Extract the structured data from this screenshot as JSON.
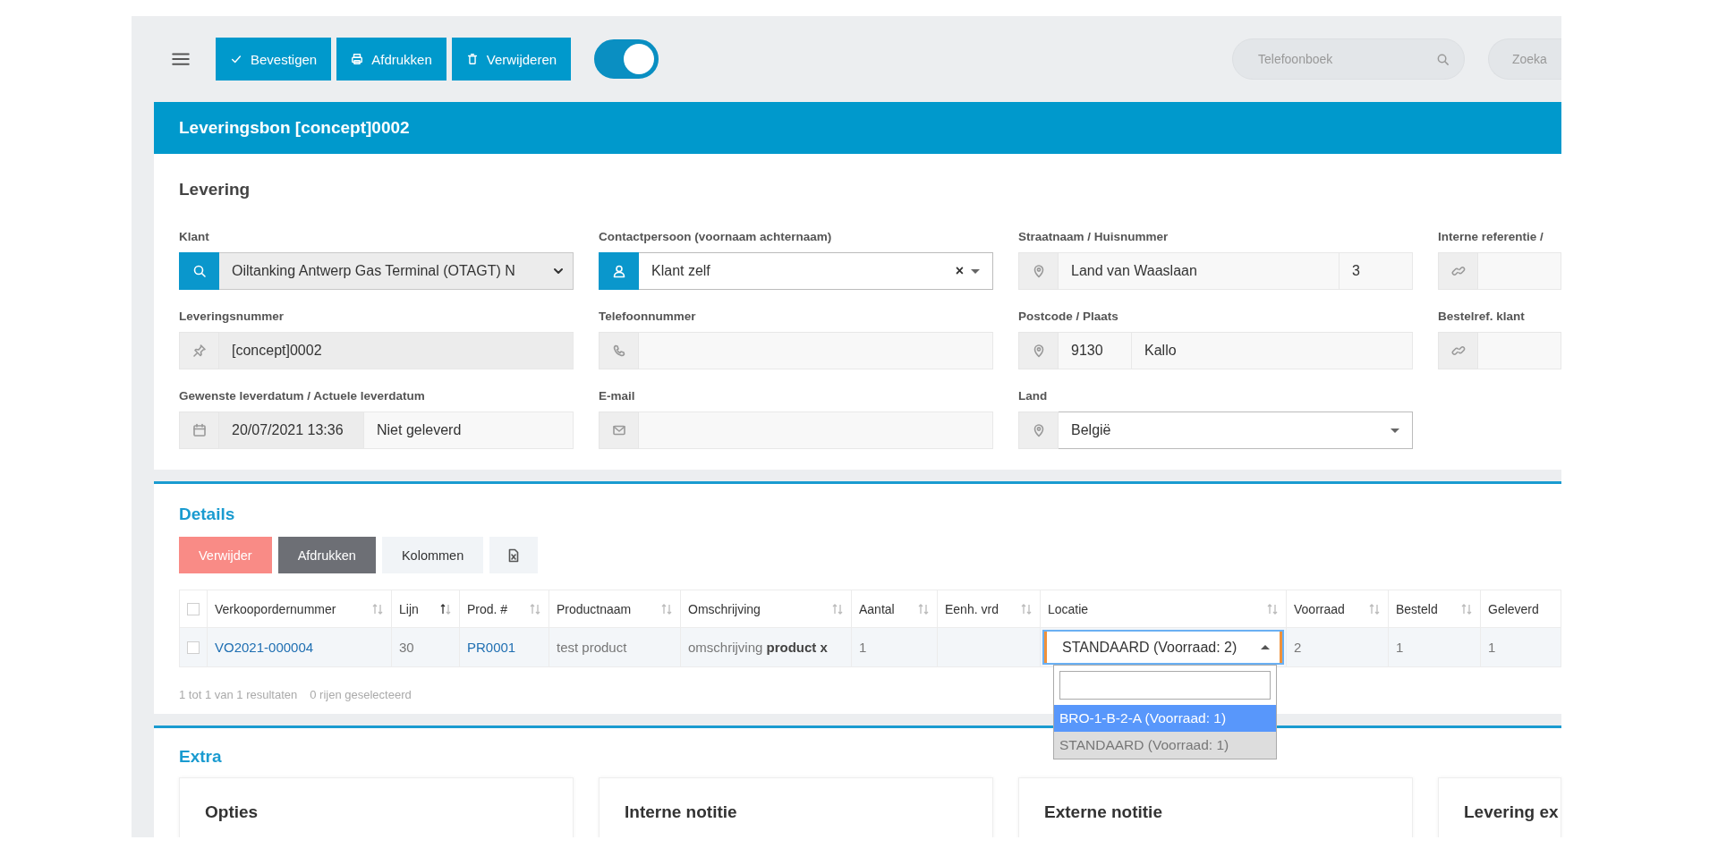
{
  "toolbar": {
    "buttons": [
      {
        "label": "Bevestigen"
      },
      {
        "label": "Afdrukken"
      },
      {
        "label": "Verwijderen"
      }
    ],
    "toggle": {
      "on": true
    },
    "searches": [
      {
        "placeholder": "Telefoonboek"
      },
      {
        "placeholder": "Zoeka"
      }
    ]
  },
  "title": "Leveringsbon [concept]0002",
  "levering": {
    "heading": "Levering",
    "fields": [
      {
        "label": "Klant",
        "accent": true,
        "segments": [
          {
            "kind": "dropdown",
            "value": "Oiltanking Antwerp Gas Terminal (OTAGT) N",
            "readonly": true
          }
        ]
      },
      {
        "label": "Contactpersoon (voornaam achternaam)",
        "accent": true,
        "segments": [
          {
            "kind": "combo",
            "value": "Klant zelf",
            "clear": "×",
            "readonly": false
          }
        ]
      },
      {
        "label": "Straatnaam / Huisnummer",
        "accent": false,
        "segments": [
          {
            "kind": "text",
            "value": "Land van Waaslaan",
            "readonly": false
          },
          {
            "kind": "text",
            "value": "3",
            "readonly": false
          }
        ]
      },
      {
        "label": "Interne referentie /",
        "accent": false,
        "segments": [
          {
            "kind": "text",
            "readonly": false
          }
        ]
      },
      {
        "label": "Leveringsnummer",
        "accent": false,
        "segments": [
          {
            "kind": "text",
            "value": "[concept]0002",
            "readonly": true
          }
        ]
      },
      {
        "label": "Telefoonnummer",
        "accent": false,
        "segments": [
          {
            "kind": "text",
            "readonly": false
          }
        ]
      },
      {
        "label": "Postcode / Plaats",
        "accent": false,
        "segments": [
          {
            "kind": "text",
            "value": "9130",
            "readonly": false
          },
          {
            "kind": "text",
            "value": "Kallo",
            "readonly": false
          }
        ]
      },
      {
        "label": "Bestelref. klant",
        "accent": false,
        "segments": [
          {
            "kind": "text",
            "readonly": false
          }
        ]
      },
      {
        "label": "Gewenste leverdatum / Actuele leverdatum",
        "accent": false,
        "segments": [
          {
            "kind": "text",
            "value": "20/07/2021 13:36",
            "readonly": true
          },
          {
            "kind": "text",
            "value": "Niet geleverd",
            "readonly": false
          }
        ]
      },
      {
        "label": "E-mail",
        "accent": false,
        "segments": [
          {
            "kind": "text",
            "readonly": false
          }
        ]
      },
      {
        "label": "Land",
        "accent": false,
        "segments": [
          {
            "kind": "combo",
            "value": "België",
            "readonly": false
          }
        ]
      }
    ]
  },
  "details": {
    "heading": "Details",
    "buttons": [
      {
        "kind": "danger",
        "label": "Verwijder"
      },
      {
        "kind": "dark",
        "label": "Afdrukken"
      },
      {
        "kind": "light",
        "label": "Kolommen"
      },
      {
        "kind": "excel"
      }
    ],
    "table": {
      "header_checked": false,
      "columns": [
        {
          "label": "Verkoopordernummer",
          "sortable": true,
          "sorted": false
        },
        {
          "label": "Lijn",
          "sortable": true,
          "sorted": true
        },
        {
          "label": "Prod. #",
          "sortable": true,
          "sorted": false
        },
        {
          "label": "Productnaam",
          "sortable": true,
          "sorted": false
        },
        {
          "label": "Omschrijving",
          "sortable": true,
          "sorted": false
        },
        {
          "label": "Aantal",
          "sortable": true,
          "sorted": false
        },
        {
          "label": "Eenh. vrd",
          "sortable": true,
          "sorted": false
        },
        {
          "label": "Locatie",
          "sortable": true,
          "sorted": false
        },
        {
          "label": "Voorraad",
          "sortable": true,
          "sorted": false
        },
        {
          "label": "Besteld",
          "sortable": true,
          "sorted": false
        },
        {
          "label": "Geleverd"
        }
      ],
      "rows": [
        {
          "checked": false,
          "cells": [
            {
              "kind": "link",
              "text": "VO2021-000004"
            },
            {
              "kind": "text",
              "text": "30"
            },
            {
              "kind": "link",
              "text": "PR0001"
            },
            {
              "kind": "text",
              "text": "test product"
            },
            {
              "kind": "rich",
              "text": "omschrijving **product x**"
            },
            {
              "kind": "text",
              "text": "1"
            },
            {
              "kind": "text"
            },
            {
              "kind": "dropdown",
              "dropdown": {
                "value": "STANDAARD (Voorraad: 2)",
                "open": true,
                "options": [
                  {
                    "label": "BRO-1-B-2-A (Voorraad: 1)",
                    "highlighted": true,
                    "selected": false
                  },
                  {
                    "label": "STANDAARD (Voorraad: 1)",
                    "highlighted": false,
                    "selected": true
                  }
                ]
              }
            },
            {
              "kind": "text",
              "text": "2"
            },
            {
              "kind": "text",
              "text": "1"
            },
            {
              "kind": "text",
              "text": "1"
            }
          ]
        }
      ]
    },
    "footer": [
      "1 tot 1 van 1 resultaten",
      "0 rijen geselecteerd"
    ]
  },
  "extra": {
    "heading": "Extra",
    "cards": [
      "Opties",
      "Interne notitie",
      "Externe notitie",
      "Levering ex"
    ]
  }
}
